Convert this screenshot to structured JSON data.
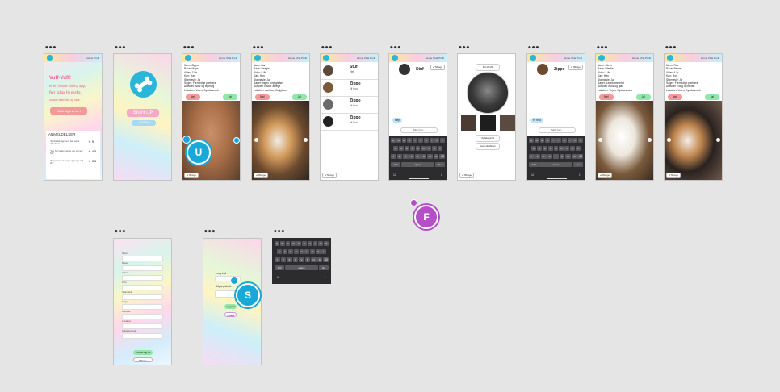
{
  "canvas": {
    "frame_menu": "•••"
  },
  "nav_links": [
    "Home",
    "Chat",
    "Profil"
  ],
  "back_button": "Tilbage",
  "frame1": {
    "title": "Vuff-Vuff!",
    "tagline1": "er en hunde dating app,",
    "tagline2": "for alle hunde,",
    "tagline3": "uanset størrelse og race.",
    "cta": "Meld dig ind her!",
    "reviews_heading": "ANMELDELSER",
    "reviews": [
      {
        "text": "\"Fantastisk app, som kan varmt anbefales\"",
        "rating": "5"
      },
      {
        "text": "\"Jeg har fundet mange nye venner! Tak\"",
        "rating": "4.5"
      },
      {
        "text": "\"Super nemt at bruge og meget sød idé\"",
        "rating": "3.5"
      }
    ]
  },
  "frame2": {
    "signup": "SIGN UP",
    "login": "LOG IN"
  },
  "profile_a": [
    "Navn: Zippo",
    "Race: Mops",
    "Alder: 11år",
    "Køn: Han",
    "Stamtavle: Ja",
    "Søger: Fremtidige partnere",
    "Aktivitet: Aktiv og legesyg",
    "Lokation: Vejen, Syddanmark"
  ],
  "profile_b": [
    "Navn: Bar",
    "Race: Beagle",
    "Alder: 5 år",
    "Køn: Hun",
    "Stamtavle: Ja",
    "Søger: Ingen forpligtelser",
    "Aktivitet: Elsker at lege",
    "Lokation: Aarhus, Midtjylland"
  ],
  "profile_c": [
    "Navn: Stevo",
    "Race: Westie",
    "Alder: 3 år",
    "Køn: Han",
    "Stamtavle: Ja",
    "Søger: Legekammerat",
    "Aktivitet: Aktiv og glad",
    "Lokation: Vejen, Syddanmark"
  ],
  "profile_d": [
    "Navn: Rox",
    "Race: Berner",
    "Alder: 4 år",
    "Køn: Hun",
    "Stamtavle: Ja",
    "Søger: Fremtidige partnere",
    "Aktivitet: Rolig og kælen",
    "Lokation: Vejen, Syddanmark"
  ],
  "buttons": {
    "nej": "Nej!",
    "ja": "Ja!"
  },
  "chat_list": [
    {
      "name": "Stuf",
      "sub": "Hej!"
    },
    {
      "name": "Zippo",
      "sub": "Hi hvo"
    },
    {
      "name": "Zippo",
      "sub": "Hi hvo"
    },
    {
      "name": "Zippo",
      "sub": "Hi hvo"
    }
  ],
  "chat_stuf": {
    "name": "Stuf",
    "bubble": "Hej!",
    "input": "Skriv her..."
  },
  "chat_zippo": {
    "name": "Zippo",
    "bubble": "Hi hvo",
    "input": "Skriv her..."
  },
  "profile_page": {
    "top": "Min Profil",
    "btn1": "Opdater profil",
    "btn2": "Gem indstillinger"
  },
  "keyboard": {
    "row1": [
      "Q",
      "W",
      "E",
      "R",
      "T",
      "Y",
      "U",
      "I",
      "O",
      "P"
    ],
    "row2": [
      "A",
      "S",
      "D",
      "F",
      "G",
      "H",
      "J",
      "K",
      "L"
    ],
    "row3": [
      "⇧",
      "Z",
      "X",
      "C",
      "V",
      "B",
      "N",
      "M",
      "⌫"
    ],
    "row4": [
      "123",
      "space",
      "Go"
    ]
  },
  "signup_form": {
    "labels": [
      "Navn",
      "Race",
      "Alder",
      "Køn",
      "Stamtavle",
      "Søger",
      "Aktivitet",
      "Lokation",
      "Adgangskode"
    ],
    "submit": "Tilmeld dig nu",
    "back": "Tilbage"
  },
  "login_form": {
    "heading": "Log ind",
    "password_label": "Adgangskode",
    "submit": "Log ind",
    "back": "Tilbage"
  },
  "cursors": {
    "u": "U",
    "f": "F",
    "s": "S"
  },
  "colors": {
    "nej": "#f29a9a",
    "ja": "#92e6a7",
    "accent": "#29b6d8",
    "cursor_u": "#1aa8d8",
    "cursor_f": "#b44fc8",
    "cursor_s": "#1aa8d8"
  }
}
